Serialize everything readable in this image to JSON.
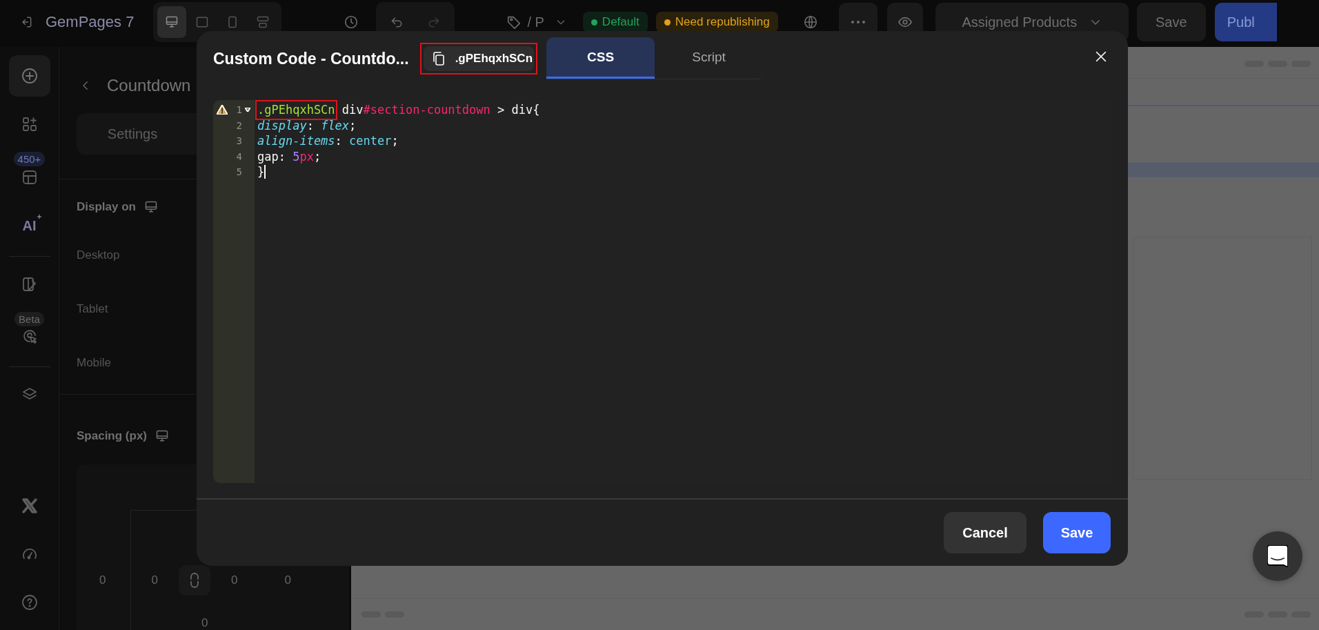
{
  "top_bar": {
    "app_name": "GemPages 7",
    "device_modes": [
      {
        "kind": "desktop",
        "selected": true
      },
      {
        "kind": "tablet",
        "selected": false
      },
      {
        "kind": "mobile",
        "selected": false
      },
      {
        "kind": "custom",
        "selected": false
      }
    ],
    "page_name": "/ P",
    "status_badges": [
      {
        "label": "Default",
        "color": "#22a35a"
      },
      {
        "label": "Need republishing",
        "color": "#e0a21a"
      }
    ],
    "assigned_products": "Assigned Products",
    "save": "Save",
    "publish": "Publ"
  },
  "rail": {
    "items": [
      {
        "kind": "add",
        "selected": true
      },
      {
        "kind": "elements",
        "selected": false
      },
      {
        "kind": "templates",
        "selected": false,
        "badge": "450+"
      },
      {
        "kind": "ai",
        "selected": false,
        "label": "AI"
      },
      {
        "kind": "pages",
        "selected": false
      },
      {
        "kind": "heatmap",
        "selected": false,
        "badge": "Beta"
      },
      {
        "kind": "layers",
        "selected": false
      },
      {
        "kind": "x",
        "selected": false
      },
      {
        "kind": "speed",
        "selected": false
      },
      {
        "kind": "help",
        "selected": false
      }
    ]
  },
  "panel": {
    "title": "Countdown",
    "tabs": [
      {
        "label": "Settings",
        "selected": false
      }
    ],
    "display_on": {
      "title": "Display on",
      "devices": [
        "Desktop",
        "Tablet",
        "Mobile"
      ]
    },
    "spacing": {
      "title": "Spacing (px)",
      "values": [
        "0",
        "0",
        "0",
        "0",
        "0"
      ]
    }
  },
  "modal": {
    "title": "Custom Code - Countdo...",
    "class_chip": {
      "label": ".gPEhqxhSCn",
      "highlighted": true
    },
    "tabs": [
      {
        "label": "CSS",
        "selected": true
      },
      {
        "label": "Script",
        "selected": false
      }
    ],
    "code": [
      {
        "number": "1",
        "warning": true,
        "foldable": true,
        "cursor": false,
        "tokens": [
          {
            "text": ".gPEhqxhSCn",
            "kind": "class",
            "highlighted": true
          },
          {
            "text": " div",
            "kind": "plain",
            "highlighted": false
          },
          {
            "text": "#section-countdown",
            "kind": "id",
            "highlighted": false
          },
          {
            "text": " > div{",
            "kind": "plain",
            "highlighted": false
          }
        ]
      },
      {
        "number": "2",
        "warning": false,
        "foldable": false,
        "cursor": false,
        "tokens": [
          {
            "text": "display",
            "kind": "prop",
            "highlighted": false
          },
          {
            "text": ": ",
            "kind": "plain",
            "highlighted": false
          },
          {
            "text": "flex",
            "kind": "keyword",
            "highlighted": false
          },
          {
            "text": ";",
            "kind": "plain",
            "highlighted": false
          }
        ]
      },
      {
        "number": "3",
        "warning": false,
        "foldable": false,
        "cursor": false,
        "tokens": [
          {
            "text": "align-items",
            "kind": "prop",
            "highlighted": false
          },
          {
            "text": ": ",
            "kind": "plain",
            "highlighted": false
          },
          {
            "text": "center",
            "kind": "value",
            "highlighted": false
          },
          {
            "text": ";",
            "kind": "plain",
            "highlighted": false
          }
        ]
      },
      {
        "number": "4",
        "warning": false,
        "foldable": false,
        "cursor": false,
        "tokens": [
          {
            "text": "gap: ",
            "kind": "plain",
            "highlighted": false
          },
          {
            "text": "5",
            "kind": "number",
            "highlighted": false
          },
          {
            "text": "px",
            "kind": "unit",
            "highlighted": false
          },
          {
            "text": ";",
            "kind": "plain",
            "highlighted": false
          }
        ]
      },
      {
        "number": "5",
        "warning": false,
        "foldable": false,
        "cursor": true,
        "tokens": [
          {
            "text": "}",
            "kind": "plain",
            "highlighted": false
          }
        ]
      }
    ],
    "cancel": "Cancel",
    "save": "Save"
  }
}
